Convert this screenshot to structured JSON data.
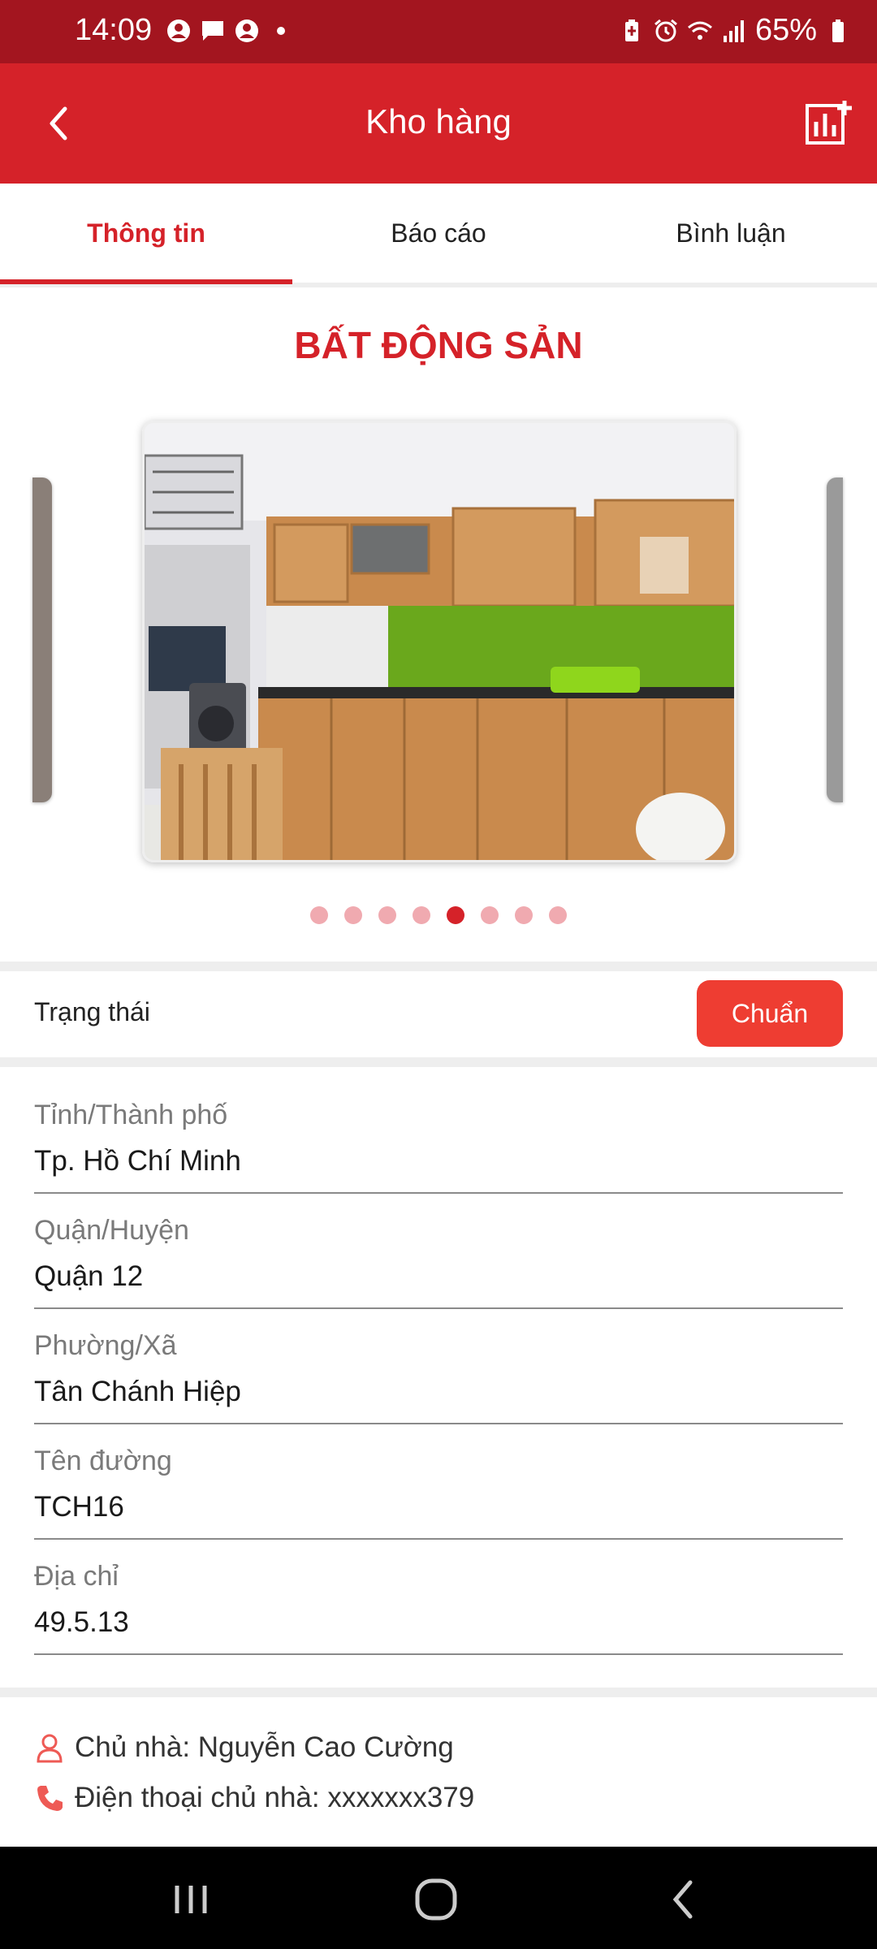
{
  "status_bar": {
    "time": "14:09",
    "battery": "65%"
  },
  "app_bar": {
    "title": "Kho hàng",
    "back_icon": "chevron-left-icon",
    "action_icon": "add-report-icon"
  },
  "tabs": [
    {
      "label": "Thông tin",
      "active": true
    },
    {
      "label": "Báo cáo",
      "active": false
    },
    {
      "label": "Bình luận",
      "active": false
    }
  ],
  "section_title": "BẤT ĐỘNG SẢN",
  "carousel": {
    "total_slides": 8,
    "active_index": 4
  },
  "status": {
    "label": "Trạng thái",
    "value": "Chuẩn"
  },
  "fields": [
    {
      "label": "Tỉnh/Thành phố",
      "value": "Tp. Hồ Chí Minh"
    },
    {
      "label": "Quận/Huyện",
      "value": "Quận 12"
    },
    {
      "label": "Phường/Xã",
      "value": "Tân Chánh Hiệp"
    },
    {
      "label": "Tên đường",
      "value": "TCH16"
    },
    {
      "label": "Địa chỉ",
      "value": "49.5.13"
    }
  ],
  "owner": {
    "name_text": "Chủ nhà: Nguyễn Cao Cường",
    "phone_text": "Điện thoại chủ nhà: xxxxxxx379"
  },
  "colors": {
    "status_bar": "#a3151f",
    "primary": "#d52229",
    "badge": "#ee3d32",
    "dot_inactive": "#f0aab0"
  }
}
